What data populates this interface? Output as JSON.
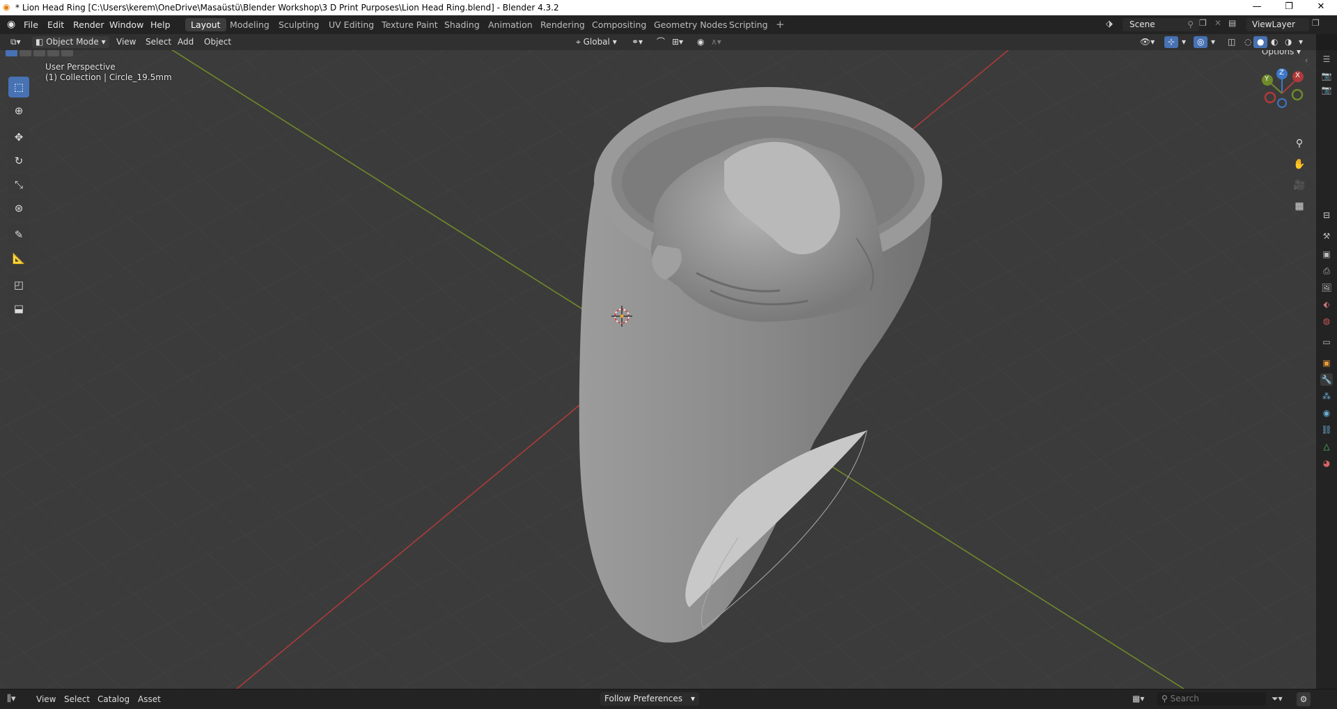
{
  "window": {
    "title": "* Lion Head Ring [C:\\Users\\kerem\\OneDrive\\Masaüstü\\Blender Workshop\\3 D Print Purposes\\Lion Head Ring.blend] - Blender 4.3.2",
    "minimize": "—",
    "maximize": "❐",
    "close": "✕"
  },
  "menubar": {
    "items": [
      "File",
      "Edit",
      "Render",
      "Window",
      "Help"
    ],
    "workspaces": [
      "Layout",
      "Modeling",
      "Sculpting",
      "UV Editing",
      "Texture Paint",
      "Shading",
      "Animation",
      "Rendering",
      "Compositing",
      "Geometry Nodes",
      "Scripting"
    ],
    "add_workspace": "+",
    "scene_label": "Scene",
    "viewlayer_label": "ViewLayer"
  },
  "header": {
    "mode": "Object Mode",
    "menus": [
      "View",
      "Select",
      "Add",
      "Object"
    ],
    "transform_orientation": "Global",
    "options_label": "Options"
  },
  "viewport": {
    "perspective_label": "User Perspective",
    "collection_label": "(1) Collection | Circle_19.5mm",
    "gizmo": {
      "x": "X",
      "y": "Y",
      "z": "Z"
    }
  },
  "bottombar": {
    "menus": [
      "View",
      "Select",
      "Catalog",
      "Asset"
    ],
    "follow_label": "Follow Preferences",
    "search_placeholder": "Search"
  },
  "colors": {
    "accent": "#4772b3",
    "axis_x": "#b03a3a",
    "axis_y": "#6e8a2a",
    "axis_z": "#3d78c8"
  }
}
